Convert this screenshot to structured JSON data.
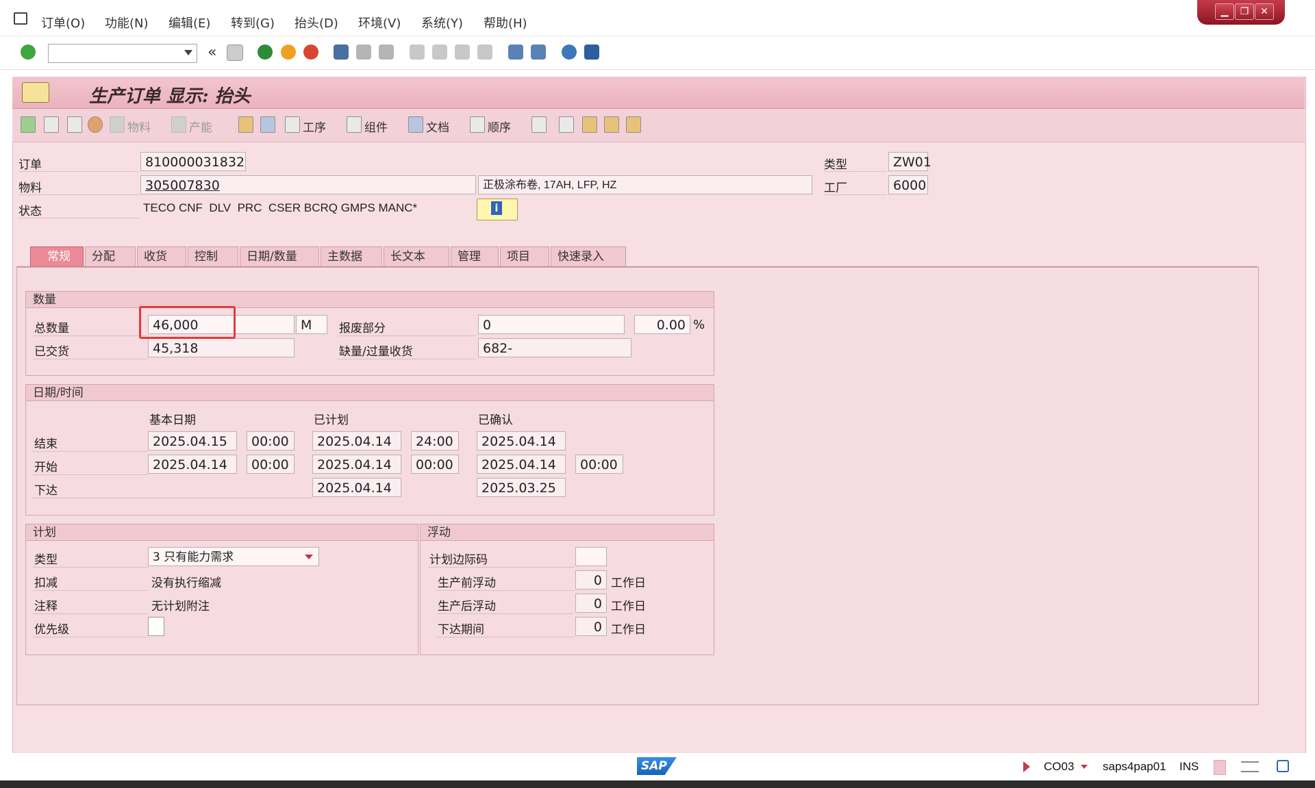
{
  "menu": {
    "items": [
      "订单(O)",
      "功能(N)",
      "编辑(E)",
      "转到(G)",
      "抬头(D)",
      "环境(V)",
      "系统(Y)",
      "帮助(H)"
    ]
  },
  "window_controls": {
    "minimize": "▁",
    "restore": "❐",
    "close": "✕"
  },
  "toolbar": {
    "command_value": ""
  },
  "title": "生产订单 显示: 抬头",
  "app_toolbar": {
    "material": "物料",
    "capacity": "产能",
    "operations": "工序",
    "components": "组件",
    "documents": "文档",
    "sequences": "顺序"
  },
  "header": {
    "order_label": "订单",
    "order_value": "810000031832",
    "material_label": "物料",
    "material_value": "305007830",
    "material_desc": "正极涂布卷, 17AH, LFP, HZ",
    "status_label": "状态",
    "status_value": "TECO CNF  DLV  PRC  CSER BCRQ GMPS MANC*",
    "type_label": "类型",
    "type_value": "ZW01",
    "plant_label": "工厂",
    "plant_value": "6000",
    "info_glyph": "i"
  },
  "tabs": [
    "常规",
    "分配",
    "收货",
    "控制",
    "日期/数量",
    "主数据",
    "长文本",
    "管理",
    "项目",
    "快速录入"
  ],
  "quantities": {
    "title": "数量",
    "total_label": "总数量",
    "total_value": "46,000",
    "unit": "M",
    "scrap_label": "报废部分",
    "scrap_value": "0",
    "scrap_pct": "0.00",
    "pct_sign": "%",
    "delivered_label": "已交货",
    "delivered_value": "45,318",
    "short_label": "缺量/过量收货",
    "short_value": "682-"
  },
  "dates": {
    "title": "日期/时间",
    "col_basic": "基本日期",
    "col_planned": "已计划",
    "col_confirmed": "已确认",
    "end_label": "结束",
    "start_label": "开始",
    "release_label": "下达",
    "end_basic_date": "2025.04.15",
    "end_basic_time": "00:00",
    "end_planned_date": "2025.04.14",
    "end_planned_time": "24:00",
    "end_confirmed_date": "2025.04.14",
    "start_basic_date": "2025.04.14",
    "start_basic_time": "00:00",
    "start_planned_date": "2025.04.14",
    "start_planned_time": "00:00",
    "start_confirmed_date": "2025.04.14",
    "start_confirmed_time": "00:00",
    "release_planned_date": "2025.04.14",
    "release_confirmed_date": "2025.03.25"
  },
  "planning": {
    "title": "计划",
    "type_label": "类型",
    "type_value": "3 只有能力需求",
    "reduction_label": "扣减",
    "reduction_value": "没有执行缩减",
    "note_label": "注释",
    "note_value": "无计划附注",
    "priority_label": "优先级"
  },
  "float": {
    "title": "浮动",
    "sm_key_label": "计划边际码",
    "before_label": "生产前浮动",
    "before_value": "0",
    "after_label": "生产后浮动",
    "after_value": "0",
    "release_label": "下达期间",
    "release_value": "0",
    "unit": "工作日"
  },
  "status_bar": {
    "transaction": "CO03",
    "server": "saps4pap01",
    "mode": "INS",
    "sap_logo": "SAP"
  }
}
